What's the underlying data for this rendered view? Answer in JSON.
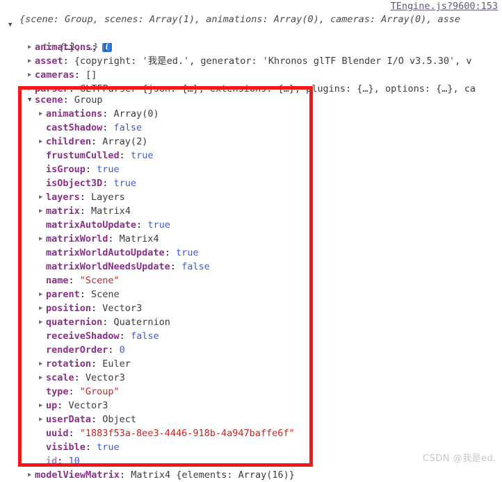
{
  "source": {
    "link_label": "TEngine.js?9600:153"
  },
  "preview": {
    "line1": "{scene: Group, scenes: Array(1), animations: Array(0), cameras: Array(0), asse",
    "line2": "t: {…}, …}",
    "info_badge": "i",
    "twisty_open": "▼"
  },
  "icons": {
    "twisty_closed": "▶",
    "twisty_open": "▼"
  },
  "top_rows": [
    {
      "indent": 40,
      "twisty": "closed",
      "prop": "animations",
      "colon": ":",
      "value": "[]",
      "value_class": "tk-obj"
    },
    {
      "indent": 40,
      "twisty": "closed",
      "prop": "asset",
      "colon": ":",
      "value": "{copyright: '我是ed.', generator: 'Khronos glTF Blender I/O v3.5.30', v",
      "value_class": "tk-obj"
    },
    {
      "indent": 40,
      "twisty": "closed",
      "prop": "cameras",
      "colon": ":",
      "value": "[]",
      "value_class": "tk-obj"
    },
    {
      "indent": 40,
      "twisty": "closed",
      "prop": "parser",
      "colon": ":",
      "value": "GLTFParser {json: {…}, extensions: {…}, plugins: {…}, options: {…}, ca",
      "value_class": "tk-obj"
    }
  ],
  "scene_rows": [
    {
      "indent": 40,
      "twisty": "open",
      "prop": "scene",
      "colon": ":",
      "value": "Group",
      "value_class": "tk-obj"
    },
    {
      "indent": 56,
      "twisty": "closed",
      "prop": "animations",
      "colon": ":",
      "value": "Array(0)",
      "value_class": "tk-obj"
    },
    {
      "indent": 56,
      "twisty": "none",
      "prop": "castShadow",
      "colon": ":",
      "value": "false",
      "value_class": "tk-bool"
    },
    {
      "indent": 56,
      "twisty": "closed",
      "prop": "children",
      "colon": ":",
      "value": "Array(2)",
      "value_class": "tk-obj"
    },
    {
      "indent": 56,
      "twisty": "none",
      "prop": "frustumCulled",
      "colon": ":",
      "value": "true",
      "value_class": "tk-bool"
    },
    {
      "indent": 56,
      "twisty": "none",
      "prop": "isGroup",
      "colon": ":",
      "value": "true",
      "value_class": "tk-bool"
    },
    {
      "indent": 56,
      "twisty": "none",
      "prop": "isObject3D",
      "colon": ":",
      "value": "true",
      "value_class": "tk-bool"
    },
    {
      "indent": 56,
      "twisty": "closed",
      "prop": "layers",
      "colon": ":",
      "value": "Layers",
      "value_class": "tk-obj"
    },
    {
      "indent": 56,
      "twisty": "closed",
      "prop": "matrix",
      "colon": ":",
      "value": "Matrix4",
      "value_class": "tk-obj"
    },
    {
      "indent": 56,
      "twisty": "none",
      "prop": "matrixAutoUpdate",
      "colon": ":",
      "value": "true",
      "value_class": "tk-bool"
    },
    {
      "indent": 56,
      "twisty": "closed",
      "prop": "matrixWorld",
      "colon": ":",
      "value": "Matrix4",
      "value_class": "tk-obj"
    },
    {
      "indent": 56,
      "twisty": "none",
      "prop": "matrixWorldAutoUpdate",
      "colon": ":",
      "value": "true",
      "value_class": "tk-bool"
    },
    {
      "indent": 56,
      "twisty": "none",
      "prop": "matrixWorldNeedsUpdate",
      "colon": ":",
      "value": "false",
      "value_class": "tk-bool"
    },
    {
      "indent": 56,
      "twisty": "none",
      "prop": "name",
      "colon": ":",
      "value": "\"Scene\"",
      "value_class": "tk-str"
    },
    {
      "indent": 56,
      "twisty": "closed",
      "prop": "parent",
      "colon": ":",
      "value": "Scene",
      "value_class": "tk-obj"
    },
    {
      "indent": 56,
      "twisty": "closed",
      "prop": "position",
      "colon": ":",
      "value": "Vector3",
      "value_class": "tk-obj"
    },
    {
      "indent": 56,
      "twisty": "closed",
      "prop": "quaternion",
      "colon": ":",
      "value": "Quaternion",
      "value_class": "tk-obj"
    },
    {
      "indent": 56,
      "twisty": "none",
      "prop": "receiveShadow",
      "colon": ":",
      "value": "false",
      "value_class": "tk-bool"
    },
    {
      "indent": 56,
      "twisty": "none",
      "prop": "renderOrder",
      "colon": ":",
      "value": "0",
      "value_class": "tk-num"
    },
    {
      "indent": 56,
      "twisty": "closed",
      "prop": "rotation",
      "colon": ":",
      "value": "Euler",
      "value_class": "tk-obj"
    },
    {
      "indent": 56,
      "twisty": "closed",
      "prop": "scale",
      "colon": ":",
      "value": "Vector3",
      "value_class": "tk-obj"
    },
    {
      "indent": 56,
      "twisty": "none",
      "prop": "type",
      "colon": ":",
      "value": "\"Group\"",
      "value_class": "tk-str"
    },
    {
      "indent": 56,
      "twisty": "closed",
      "prop": "up",
      "colon": ":",
      "value": "Vector3",
      "value_class": "tk-obj"
    },
    {
      "indent": 56,
      "twisty": "closed",
      "prop": "userData",
      "colon": ":",
      "value": "Object",
      "value_class": "tk-obj"
    },
    {
      "indent": 56,
      "twisty": "none",
      "prop": "uuid",
      "colon": ":",
      "value": "\"1883f53a-8ee3-4446-918b-4a947baffe6f\"",
      "value_class": "tk-str"
    },
    {
      "indent": 56,
      "twisty": "none",
      "prop": "visible",
      "colon": ":",
      "value": "true",
      "value_class": "tk-bool"
    },
    {
      "indent": 56,
      "twisty": "none",
      "prop": "id",
      "colon": ":",
      "value": "10",
      "value_class": "tk-num",
      "dim": true
    }
  ],
  "bottom_row": {
    "indent": 40,
    "twisty": "closed",
    "prop": "modelViewMatrix",
    "colon": ":",
    "value": "Matrix4 {elements: Array(16)}",
    "value_class": "tk-obj"
  },
  "annotation": {
    "box_color": "#f01818"
  },
  "watermark": {
    "text": "CSDN @我是ed."
  }
}
